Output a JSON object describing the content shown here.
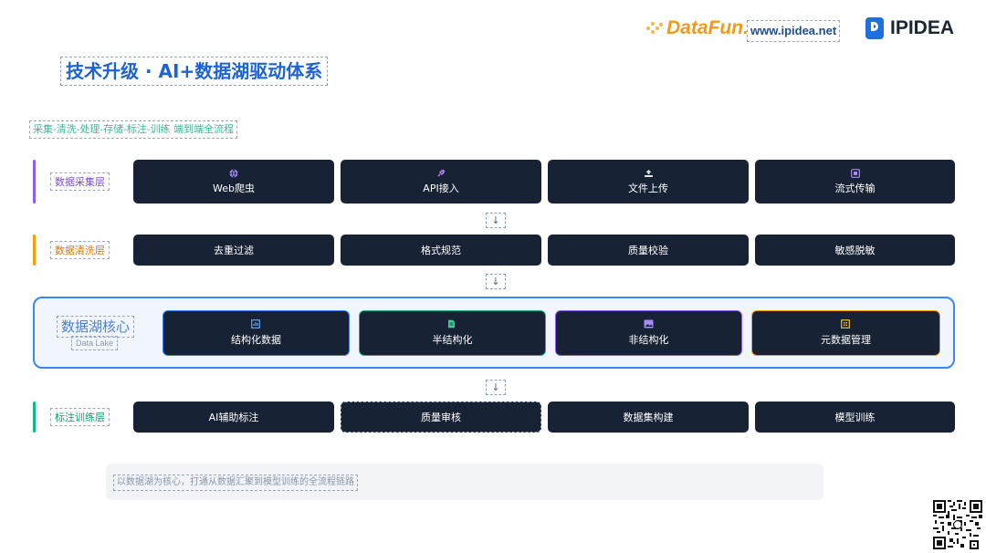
{
  "header": {
    "datafun_logo": "DataFun.",
    "url": "www.ipidea.net",
    "ipidea_logo": "IPIDEA"
  },
  "title": "技术升级 · AI+数据湖驱动体系",
  "subtitle": "采集-清洗-处理-存储-标注-训练 端到端全流程",
  "layers": {
    "collect": {
      "label": "数据采集层",
      "color": "#8b5cf6",
      "items": [
        {
          "label": "Web爬虫",
          "icon": "globe-icon"
        },
        {
          "label": "API接入",
          "icon": "plug-icon"
        },
        {
          "label": "文件上传",
          "icon": "upload-icon"
        },
        {
          "label": "流式传输",
          "icon": "stream-icon"
        }
      ]
    },
    "clean": {
      "label": "数据清洗层",
      "color": "#f59e0b",
      "items": [
        "去重过滤",
        "格式规范",
        "质量校验",
        "敏感脱敏"
      ]
    },
    "lake": {
      "title": "数据湖核心",
      "subtitle": "Data Lake",
      "items": [
        {
          "label": "结构化数据",
          "icon": "table-icon",
          "border": "#3b82f6"
        },
        {
          "label": "半结构化",
          "icon": "document-icon",
          "border": "#10b981"
        },
        {
          "label": "非结构化",
          "icon": "image-icon",
          "border": "#8b5cf6"
        },
        {
          "label": "元数据管理",
          "icon": "grid-icon",
          "border": "#f59e0b"
        }
      ]
    },
    "label_train": {
      "label": "标注训练层",
      "color": "#10b981",
      "items": [
        "AI辅助标注",
        "质量审核",
        "数据集构建",
        "模型训练"
      ]
    }
  },
  "arrows": [
    "↓",
    "↓",
    "↓"
  ],
  "footer": "以数据湖为核心，打通从数据汇聚到模型训练的全流程链路"
}
